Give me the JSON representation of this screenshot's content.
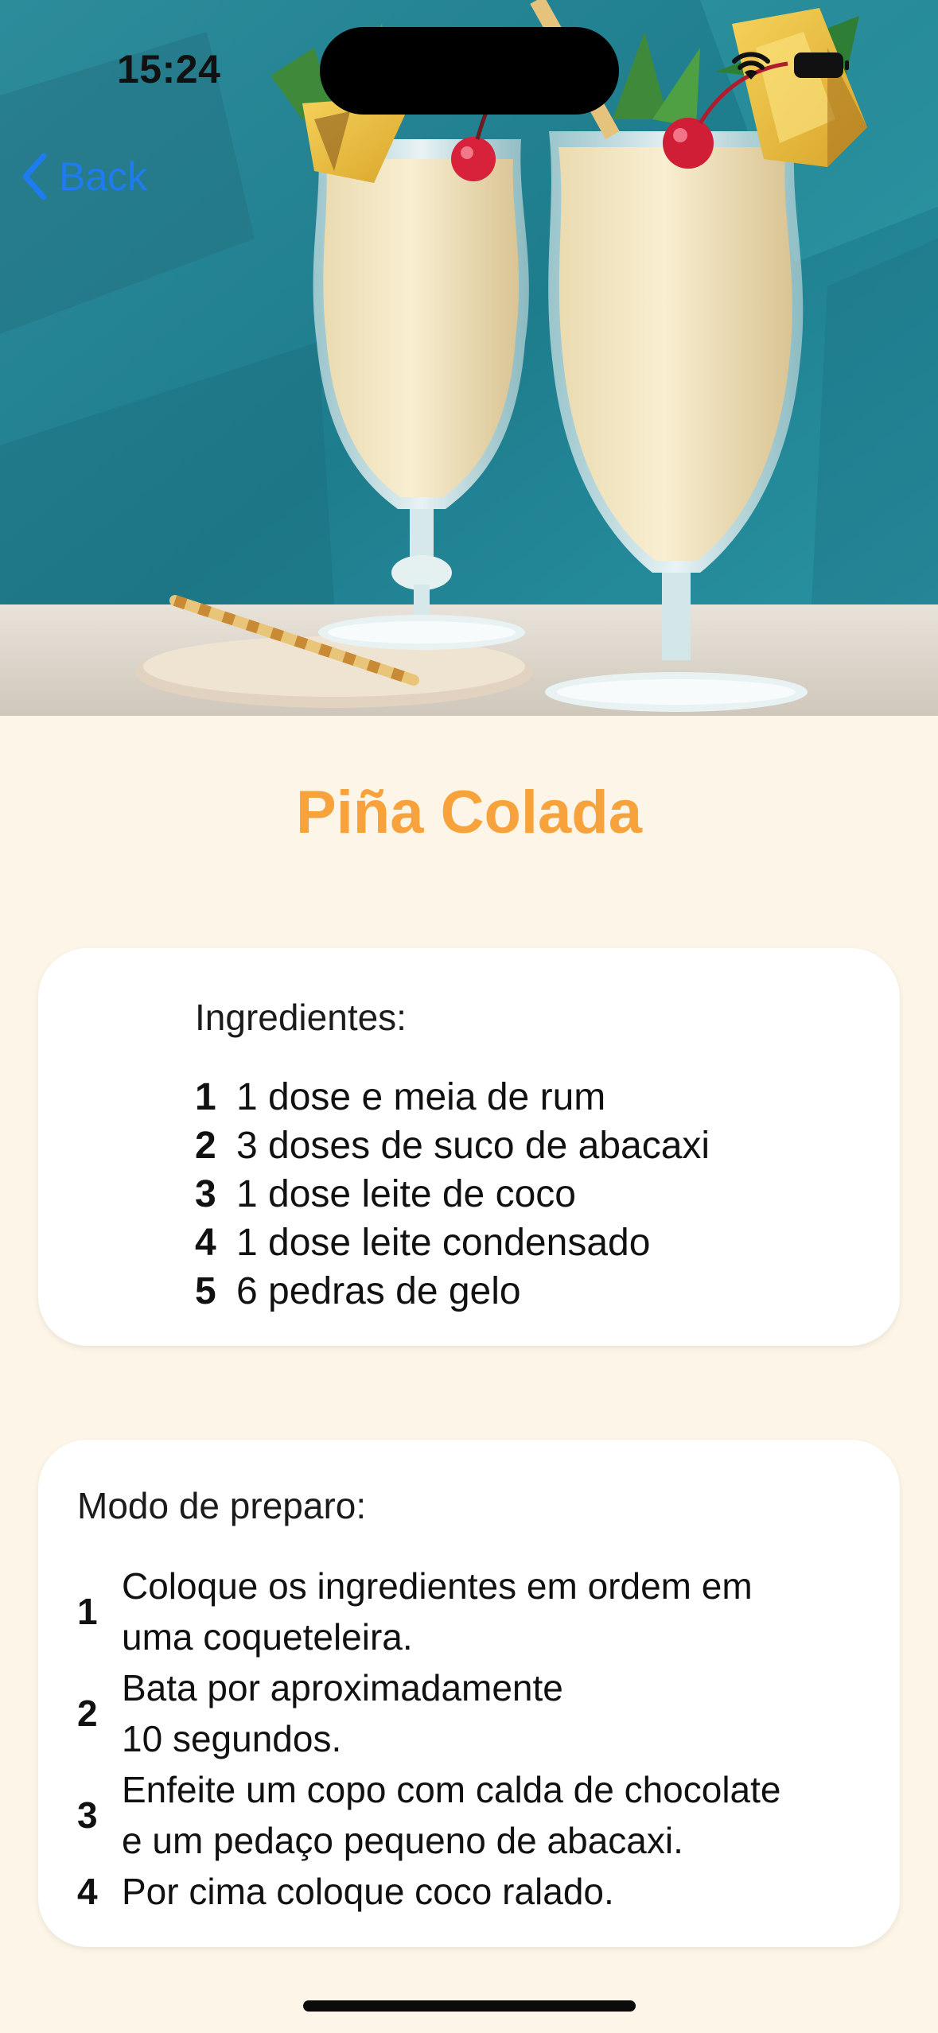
{
  "status_bar": {
    "time": "15:24"
  },
  "nav": {
    "back_label": "Back"
  },
  "hero": {
    "image_name": "pina-colada-photo"
  },
  "title": "Piña Colada",
  "ingredients": {
    "heading": "Ingredientes:",
    "items": [
      {
        "num": "1",
        "text": "1 dose e meia de rum"
      },
      {
        "num": "2",
        "text": "3 doses de suco de abacaxi"
      },
      {
        "num": "3",
        "text": "1 dose leite de coco"
      },
      {
        "num": "4",
        "text": "1 dose leite condensado"
      },
      {
        "num": "5",
        "text": "6 pedras de gelo"
      }
    ]
  },
  "preparation": {
    "heading": "Modo de preparo:",
    "steps": [
      {
        "num": "1",
        "text": "Coloque os ingredientes em ordem em\numa coqueteleira."
      },
      {
        "num": "2",
        "text": "Bata por aproximadamente\n10 segundos."
      },
      {
        "num": "3",
        "text": "Enfeite um copo com calda de chocolate\ne um pedaço pequeno de abacaxi."
      },
      {
        "num": "4",
        "text": "Por cima coloque coco ralado."
      }
    ]
  },
  "colors": {
    "background": "#FDF6E8",
    "title": "#F7A23B",
    "link": "#1E7CF0",
    "card": "#FFFFFF"
  }
}
